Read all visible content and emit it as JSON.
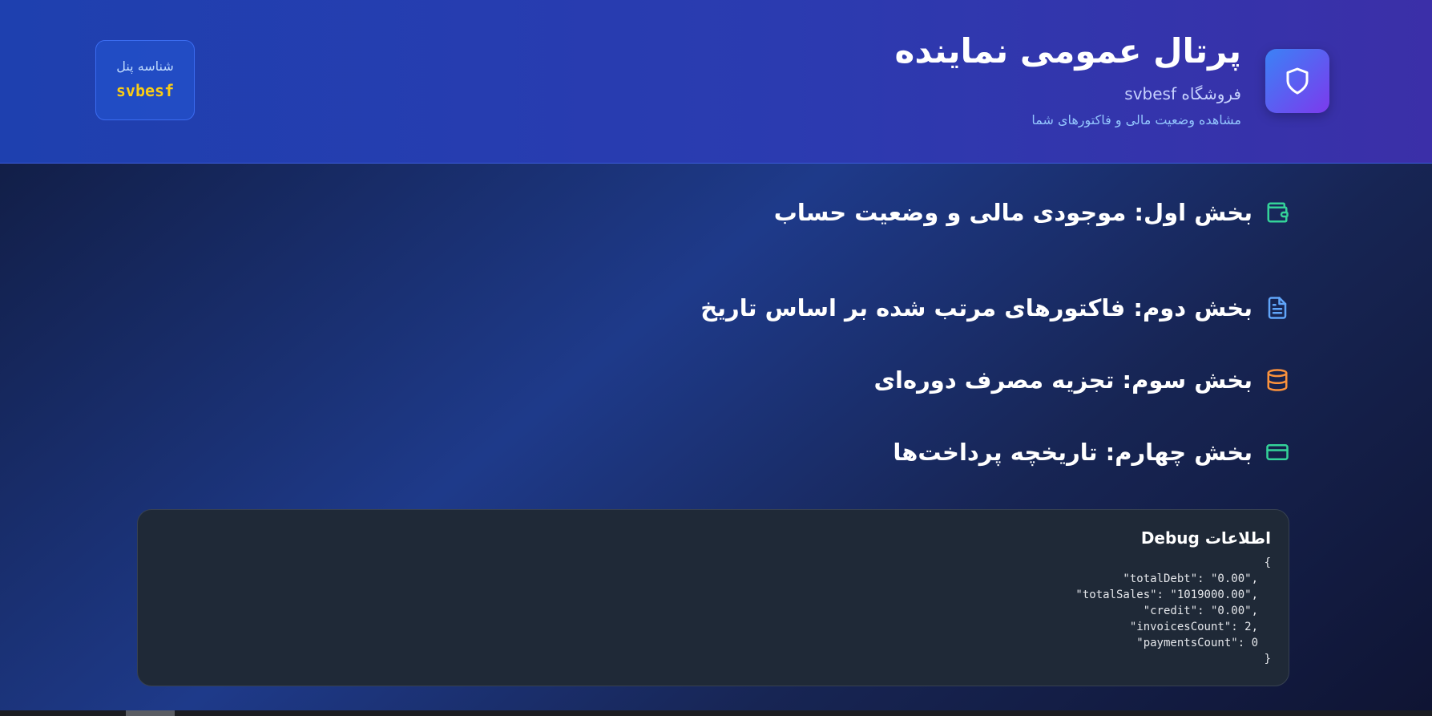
{
  "header": {
    "title": "پرتال عمومی نماینده",
    "store_name": "فروشگاه svbesf",
    "subtitle": "مشاهده وضعیت مالی و فاکتورهای شما",
    "brand_icon": "shield-icon",
    "panel_id": {
      "label": "شناسه پنل",
      "value": "svbesf"
    }
  },
  "sections": [
    {
      "title": "بخش اول: موجودی مالی و وضعیت حساب",
      "icon": "wallet-icon",
      "color": "#34d399"
    },
    {
      "title": "بخش دوم: فاکتورهای مرتب شده بر اساس تاریخ",
      "icon": "document-icon",
      "color": "#60a5fa"
    },
    {
      "title": "بخش سوم: تجزیه مصرف دوره‌ای",
      "icon": "database-icon",
      "color": "#fb923c"
    },
    {
      "title": "بخش چهارم: تاریخچه پرداخت‌ها",
      "icon": "credit-card-icon",
      "color": "#34d399"
    }
  ],
  "debug": {
    "title": "اطلاعات Debug",
    "lines": [
      "}",
      ",\"totalDebt\": \"0.00\"",
      ",\"totalSales\": \"1019000.00\"",
      ",\"credit\": \"0.00\"",
      ",invoicesCount\": 2\"",
      "paymentsCount\": 0\"",
      "{"
    ]
  },
  "colors": {
    "header_start": "#1e40af",
    "header_end": "#3b2fa8",
    "panel_id_value": "#facc15",
    "debug_bg": "#1f2937"
  }
}
